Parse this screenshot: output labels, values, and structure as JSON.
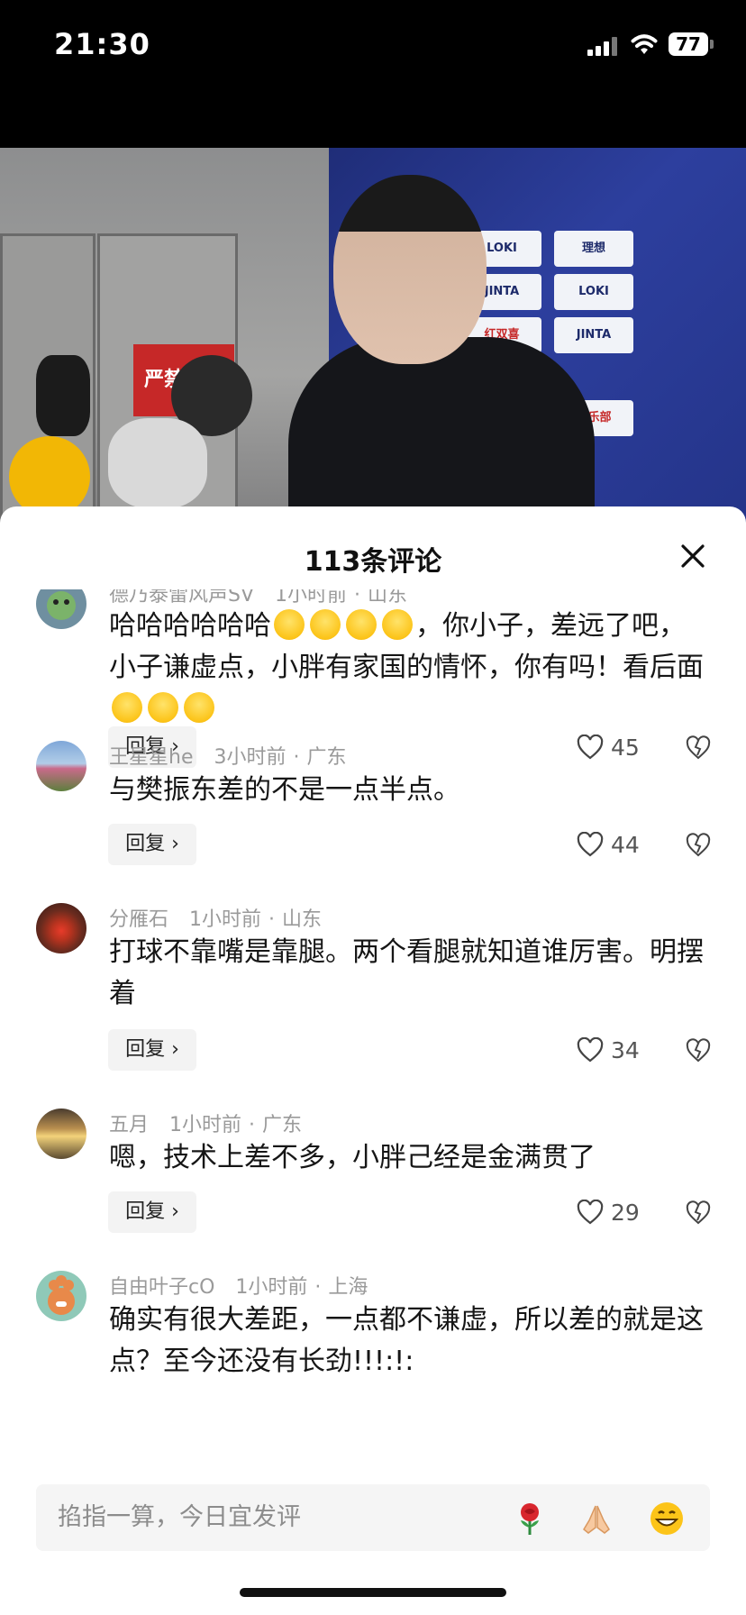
{
  "status_bar": {
    "time": "21:30",
    "battery": "77"
  },
  "sheet": {
    "title": "113条评论"
  },
  "comments": [
    {
      "user": "德乃泰雷风声SV",
      "time": "1小时前",
      "location": "山东",
      "text_part1": "哈哈哈哈哈哈",
      "text_part2": "，你小子，差远了吧，小子谦虚点，小胖有家国的情怀，你有吗！看后面",
      "reply_label": "回复",
      "likes": "45"
    },
    {
      "user": "王星星he",
      "time": "3小时前",
      "location": "广东",
      "text": "与樊振东差的不是一点半点。",
      "reply_label": "回复",
      "likes": "44"
    },
    {
      "user": "分雁石",
      "time": "1小时前",
      "location": "山东",
      "text": "打球不靠嘴是靠腿。两个看腿就知道谁厉害。明摆着",
      "reply_label": "回复",
      "likes": "34"
    },
    {
      "user": "五月",
      "time": "1小时前",
      "location": "广东",
      "text": "嗯，技术上差不多，小胖己经是金满贯了",
      "reply_label": "回复",
      "likes": "29"
    },
    {
      "user": "自由叶子cO",
      "time": "1小时前",
      "location": "上海",
      "text": "确实有很大差距，一点都不谦虚，所以差的就是这点？至今还没有长劲!!!:!:"
    }
  ],
  "input": {
    "placeholder": "掐指一算，今日宜发评"
  },
  "video": {
    "sign_text": "严禁出入"
  },
  "colors": {
    "sheet_bg": "#ffffff",
    "meta_gray": "#9a9a9a",
    "reply_bg": "#f3f3f3"
  }
}
